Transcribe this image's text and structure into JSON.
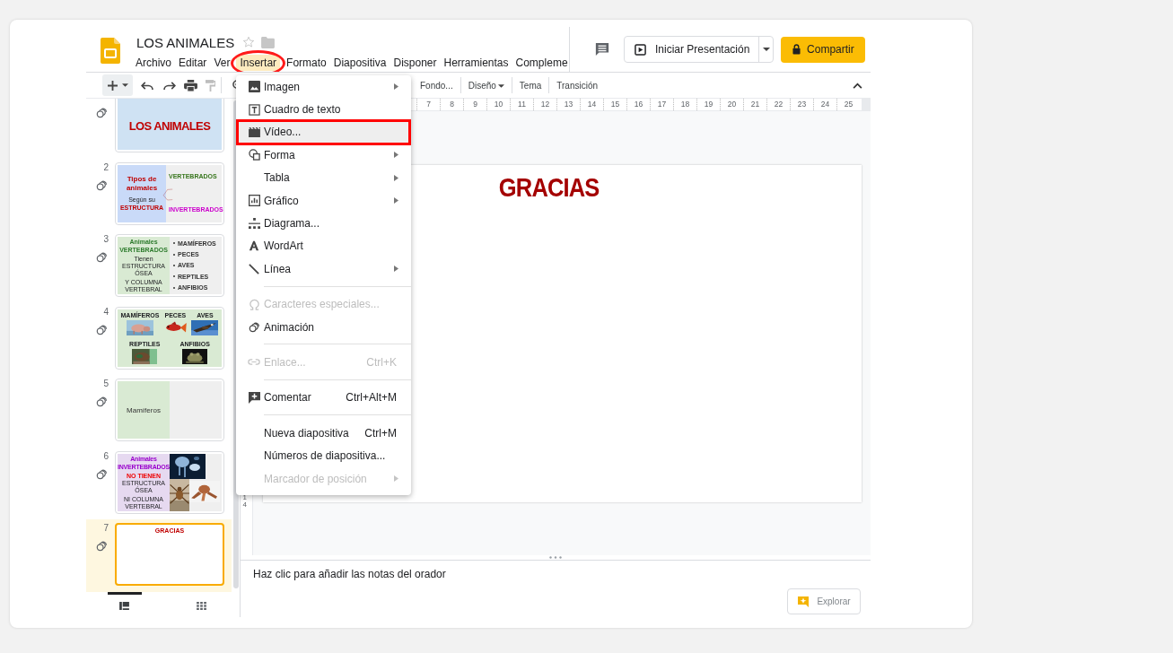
{
  "document": {
    "title": "LOS ANIMALES"
  },
  "menubar": [
    {
      "label": "Archivo",
      "selected": false,
      "annotated": false
    },
    {
      "label": "Editar",
      "selected": false,
      "annotated": false
    },
    {
      "label": "Ver",
      "selected": false,
      "annotated": false
    },
    {
      "label": "Insertar",
      "selected": true,
      "annotated": true
    },
    {
      "label": "Formato",
      "selected": false,
      "annotated": false
    },
    {
      "label": "Diapositiva",
      "selected": false,
      "annotated": false
    },
    {
      "label": "Disponer",
      "selected": false,
      "annotated": false
    },
    {
      "label": "Herramientas",
      "selected": false,
      "annotated": false
    },
    {
      "label": "Compleme",
      "selected": false,
      "annotated": false
    }
  ],
  "header": {
    "present_label": "Iniciar Presentación",
    "share_label": "Compartir"
  },
  "toolbar": [
    {
      "label": "Fondo...",
      "dropdown": false
    },
    {
      "label": "Diseño",
      "dropdown": true
    },
    {
      "label": "Tema",
      "dropdown": false
    },
    {
      "label": "Transición",
      "dropdown": false
    }
  ],
  "ruler": [
    "7",
    "8",
    "9",
    "10",
    "11",
    "12",
    "13",
    "14",
    "15",
    "16",
    "17",
    "18",
    "19",
    "20",
    "21",
    "22",
    "23",
    "24",
    "25"
  ],
  "vertical_ruler": [
    "14"
  ],
  "slides": [
    {
      "kind": "title",
      "selected": false,
      "title": "LOS ANIMALES"
    },
    {
      "number": "2",
      "kind": "diagram",
      "selected": false,
      "title": "Tipos de animales",
      "subtitle": "Según su **ESTRUCTURA**",
      "branches": [
        {
          "label": "VERTEBRADOS",
          "color": "#38761d"
        },
        {
          "label": "INVERTEBRADOS",
          "color": "#cc00cc"
        }
      ]
    },
    {
      "number": "3",
      "kind": "list",
      "selected": false,
      "title": "Animales VERTEBRADOS",
      "lines": [
        "Tienen ESTRUCTURA ÓSEA",
        "Y COLUMNA VERTEBRAL"
      ],
      "bullets": [
        "MAMÍFEROS",
        "PECES",
        "AVES",
        "REPTILES",
        "ANFIBIOS"
      ]
    },
    {
      "number": "4",
      "kind": "gallery",
      "selected": false,
      "captions": [
        "MAMÍFEROS",
        "PECES",
        "AVES",
        "REPTILES",
        "ANFIBIOS"
      ]
    },
    {
      "number": "5",
      "kind": "section",
      "selected": false,
      "title": "Mamíferos"
    },
    {
      "number": "6",
      "kind": "split",
      "selected": false,
      "title": "Animales INVERTEBRADOS",
      "lines": [
        "**NO TIENEN** ESTRUCTURA ÓSEA",
        "NI COLUMNA VERTEBRAL"
      ]
    },
    {
      "number": "7",
      "kind": "closing",
      "selected": true,
      "title": "GRACIAS"
    }
  ],
  "panel_views": [
    {
      "selected": true
    },
    {
      "selected": false
    }
  ],
  "canvas": {
    "title": "GRACIAS"
  },
  "notes": {
    "placeholder": "Haz clic para añadir las notas del orador"
  },
  "explore_label": "Explorar",
  "insert_menu": [
    {
      "kind": "item",
      "label": "Imagen",
      "submenu": true,
      "disabled": false,
      "hovered": false,
      "annotated": false
    },
    {
      "kind": "item",
      "label": "Cuadro de texto",
      "submenu": false,
      "disabled": false,
      "hovered": false,
      "annotated": false
    },
    {
      "kind": "item",
      "label": "Vídeo...",
      "submenu": false,
      "disabled": false,
      "hovered": true,
      "annotated": true
    },
    {
      "kind": "item",
      "label": "Forma",
      "submenu": true,
      "disabled": false,
      "hovered": false,
      "annotated": false
    },
    {
      "kind": "item",
      "label": "Tabla",
      "submenu": true,
      "disabled": false,
      "hovered": false,
      "annotated": false
    },
    {
      "kind": "item",
      "label": "Gráfico",
      "submenu": true,
      "disabled": false,
      "hovered": false,
      "annotated": false
    },
    {
      "kind": "item",
      "label": "Diagrama...",
      "submenu": false,
      "disabled": false,
      "hovered": false,
      "annotated": false
    },
    {
      "kind": "item",
      "label": "WordArt",
      "submenu": false,
      "disabled": false,
      "hovered": false,
      "annotated": false
    },
    {
      "kind": "item",
      "label": "Línea",
      "submenu": true,
      "disabled": false,
      "hovered": false,
      "annotated": false
    },
    {
      "kind": "separator"
    },
    {
      "kind": "item",
      "label": "Caracteres especiales...",
      "submenu": false,
      "disabled": true,
      "hovered": false,
      "annotated": false
    },
    {
      "kind": "item",
      "label": "Animación",
      "submenu": false,
      "disabled": false,
      "hovered": false,
      "annotated": false
    },
    {
      "kind": "separator"
    },
    {
      "kind": "item",
      "label": "Enlace...",
      "shortcut": "Ctrl+K",
      "submenu": false,
      "disabled": true,
      "hovered": false,
      "annotated": false
    },
    {
      "kind": "separator"
    },
    {
      "kind": "item",
      "label": "Comentar",
      "shortcut": "Ctrl+Alt+M",
      "submenu": false,
      "disabled": false,
      "hovered": false,
      "annotated": false
    },
    {
      "kind": "separator"
    },
    {
      "kind": "item",
      "label": "Nueva diapositiva",
      "shortcut": "Ctrl+M",
      "submenu": false,
      "disabled": false,
      "hovered": false,
      "annotated": false
    },
    {
      "kind": "item",
      "label": "Números de diapositiva...",
      "submenu": false,
      "disabled": false,
      "hovered": false,
      "annotated": false
    },
    {
      "kind": "item",
      "label": "Marcador de posición",
      "submenu": true,
      "disabled": true,
      "hovered": false,
      "annotated": false
    }
  ]
}
